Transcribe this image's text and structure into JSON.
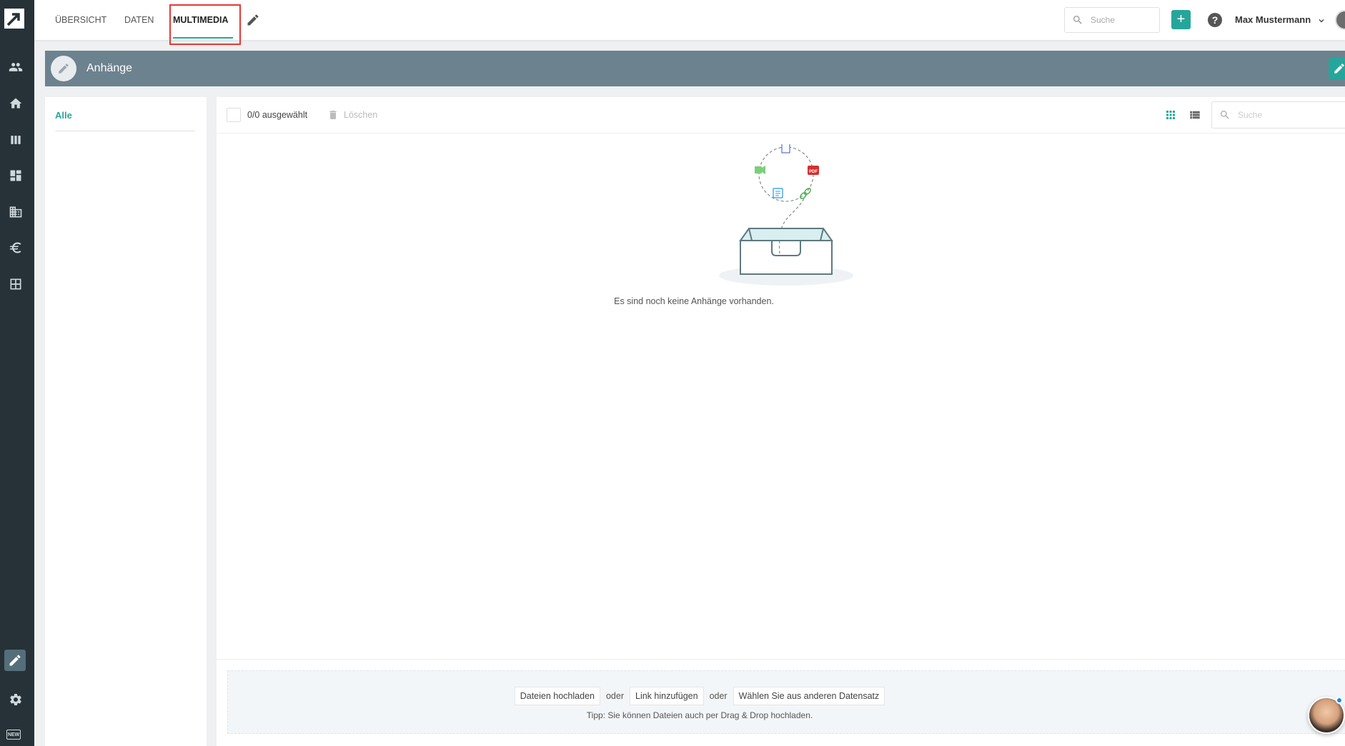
{
  "sidebar": {
    "new_badge": "NEW"
  },
  "topbar": {
    "tabs": [
      {
        "label": "ÜBERSICHT"
      },
      {
        "label": "DATEN"
      },
      {
        "label": "MULTIMEDIA"
      }
    ],
    "search_placeholder": "Suche",
    "add_label": "+",
    "help_label": "?",
    "user_name": "Max Mustermann"
  },
  "section": {
    "title": "Anhänge"
  },
  "filter": {
    "items": [
      {
        "label": "Alle"
      }
    ]
  },
  "toolbar": {
    "selection_count": "0/0 ausgewählt",
    "delete_label": "Löschen",
    "search_placeholder": "Suche"
  },
  "empty_state": {
    "message": "Es sind noch keine Anhänge vorhanden.",
    "pdf_label": "PDF"
  },
  "upload": {
    "upload_files": "Dateien hochladen",
    "or_1": "oder",
    "add_link": "Link hinzufügen",
    "or_2": "oder",
    "choose_other": "Wählen Sie aus anderen Datensatz",
    "tip": "Tipp: Sie können Dateien auch per Drag & Drop hochladen."
  },
  "colors": {
    "accent": "#26a69a",
    "sidebar_bg": "#263238",
    "header_bg": "#6d828f",
    "highlight": "#e53935"
  }
}
